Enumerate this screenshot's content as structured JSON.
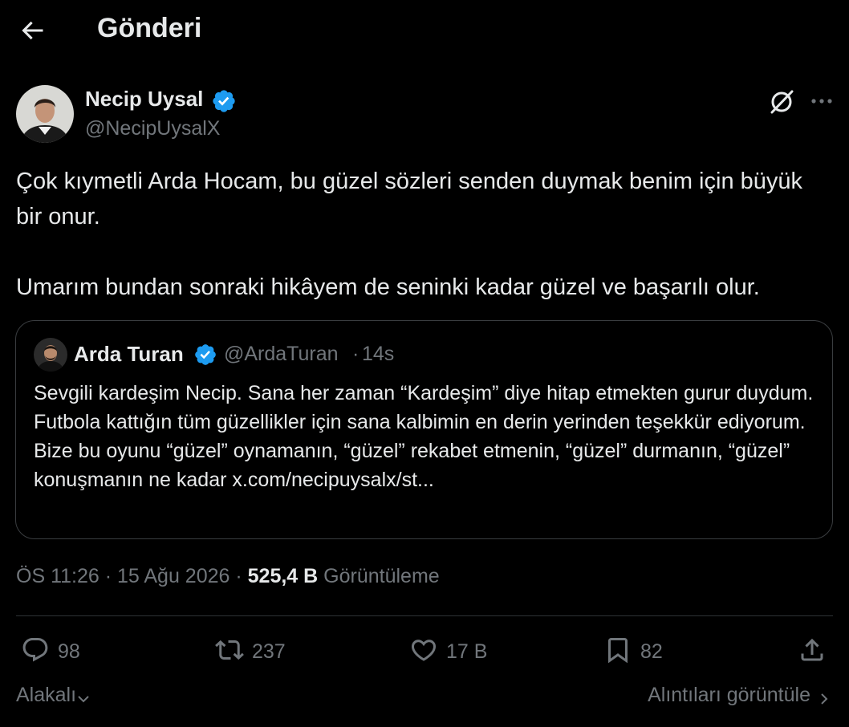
{
  "header": {
    "title": "Gönderi"
  },
  "post": {
    "author_name": "Necip Uysal",
    "author_handle": "@NecipUysalX",
    "body_line1": "Çok kıymetli Arda Hocam, bu güzel sözleri senden duymak benim için büyük bir onur.",
    "body_line2": "Umarım bundan sonraki hikâyem de seninki kadar güzel ve başarılı olur.",
    "timestamp": "ÖS 11:26 · 15 Ağu 2026 ·",
    "views_count": "525,4 B",
    "views_label": "Görüntüleme"
  },
  "quote": {
    "author_name": "Arda Turan",
    "author_handle": "@ArdaTuran",
    "separator": "·",
    "time": "14s",
    "text": "Sevgili kardeşim Necip. Sana her zaman “Kardeşim” diye hitap etmekten gurur duydum. Futbola kattığın tüm güzellikler için sana kalbimin en derin yerinden teşekkür ediyorum. Bize bu oyunu “güzel” oynamanın, “güzel” rekabet etmenin, “güzel” durmanın, “güzel” konuşmanın ne kadar x.com/necipuysalx/st..."
  },
  "actions": {
    "replies": "98",
    "reposts": "237",
    "likes": "17 B",
    "bookmarks": "82"
  },
  "footer": {
    "sort_label": "Alakalı",
    "quotes_link": "Alıntıları görüntüle"
  },
  "colors": {
    "background": "#000000",
    "text_primary": "#e7e9ea",
    "text_secondary": "#71767b",
    "verified_blue": "#1d9bf0",
    "border": "#2f3336"
  },
  "icons": [
    "back-arrow-icon",
    "verified-badge-icon",
    "grok-icon",
    "more-icon",
    "reply-icon",
    "repost-icon",
    "like-icon",
    "bookmark-icon",
    "share-icon",
    "chevron-down-icon",
    "chevron-right-icon"
  ]
}
